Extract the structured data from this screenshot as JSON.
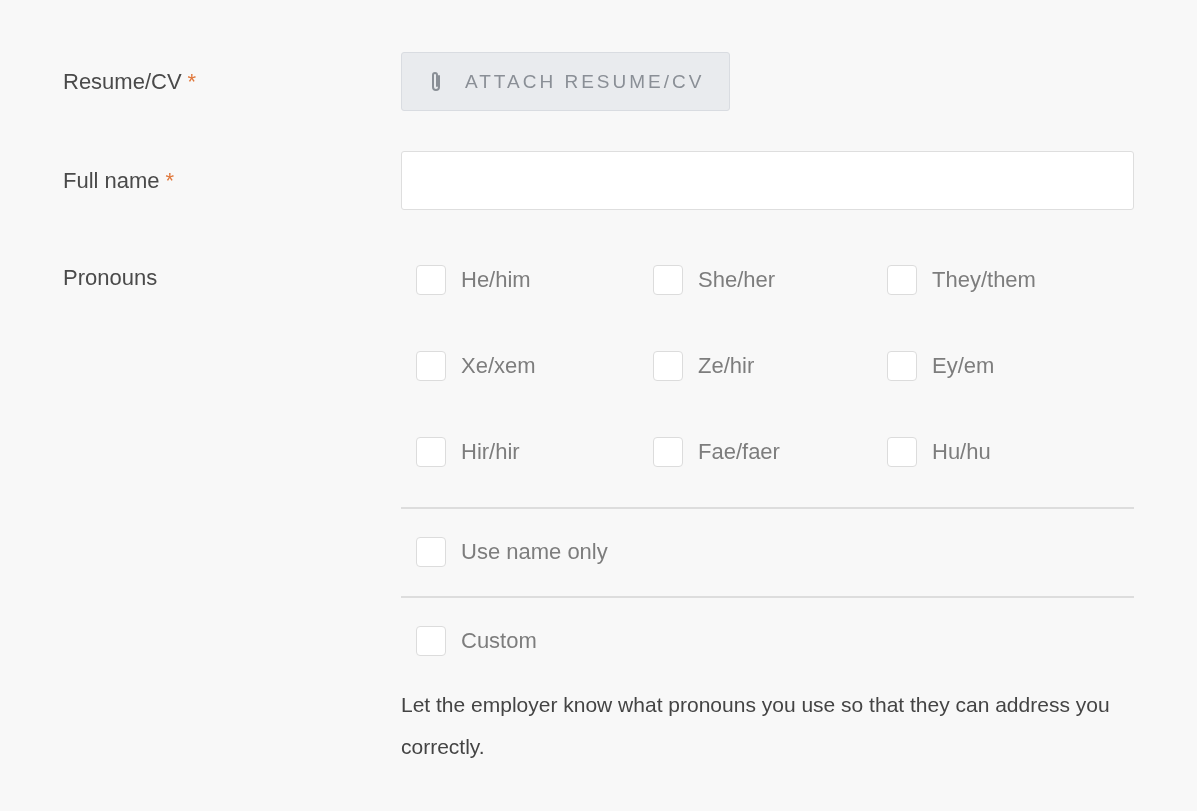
{
  "fields": [
    {
      "kind": "file",
      "label": "Resume/CV",
      "required_mark": "*",
      "button": "ATTACH RESUME/CV"
    },
    {
      "kind": "text",
      "label": "Full name",
      "required_mark": "*"
    },
    {
      "kind": "checkboxes",
      "label": "Pronouns",
      "options": [
        {
          "label": "He/him",
          "checked": false
        },
        {
          "label": "She/her",
          "checked": false
        },
        {
          "label": "They/them",
          "checked": false
        },
        {
          "label": "Xe/xem",
          "checked": false
        },
        {
          "label": "Ze/hir",
          "checked": false
        },
        {
          "label": "Ey/em",
          "checked": false
        },
        {
          "label": "Hir/hir",
          "checked": false
        },
        {
          "label": "Fae/faer",
          "checked": false
        },
        {
          "label": "Hu/hu",
          "checked": false
        }
      ],
      "extra_options": [
        {
          "label": "Use name only",
          "checked": false
        },
        {
          "label": "Custom",
          "checked": false
        }
      ],
      "help": "Let the employer know what pronouns you use so that they can address you correctly."
    }
  ]
}
